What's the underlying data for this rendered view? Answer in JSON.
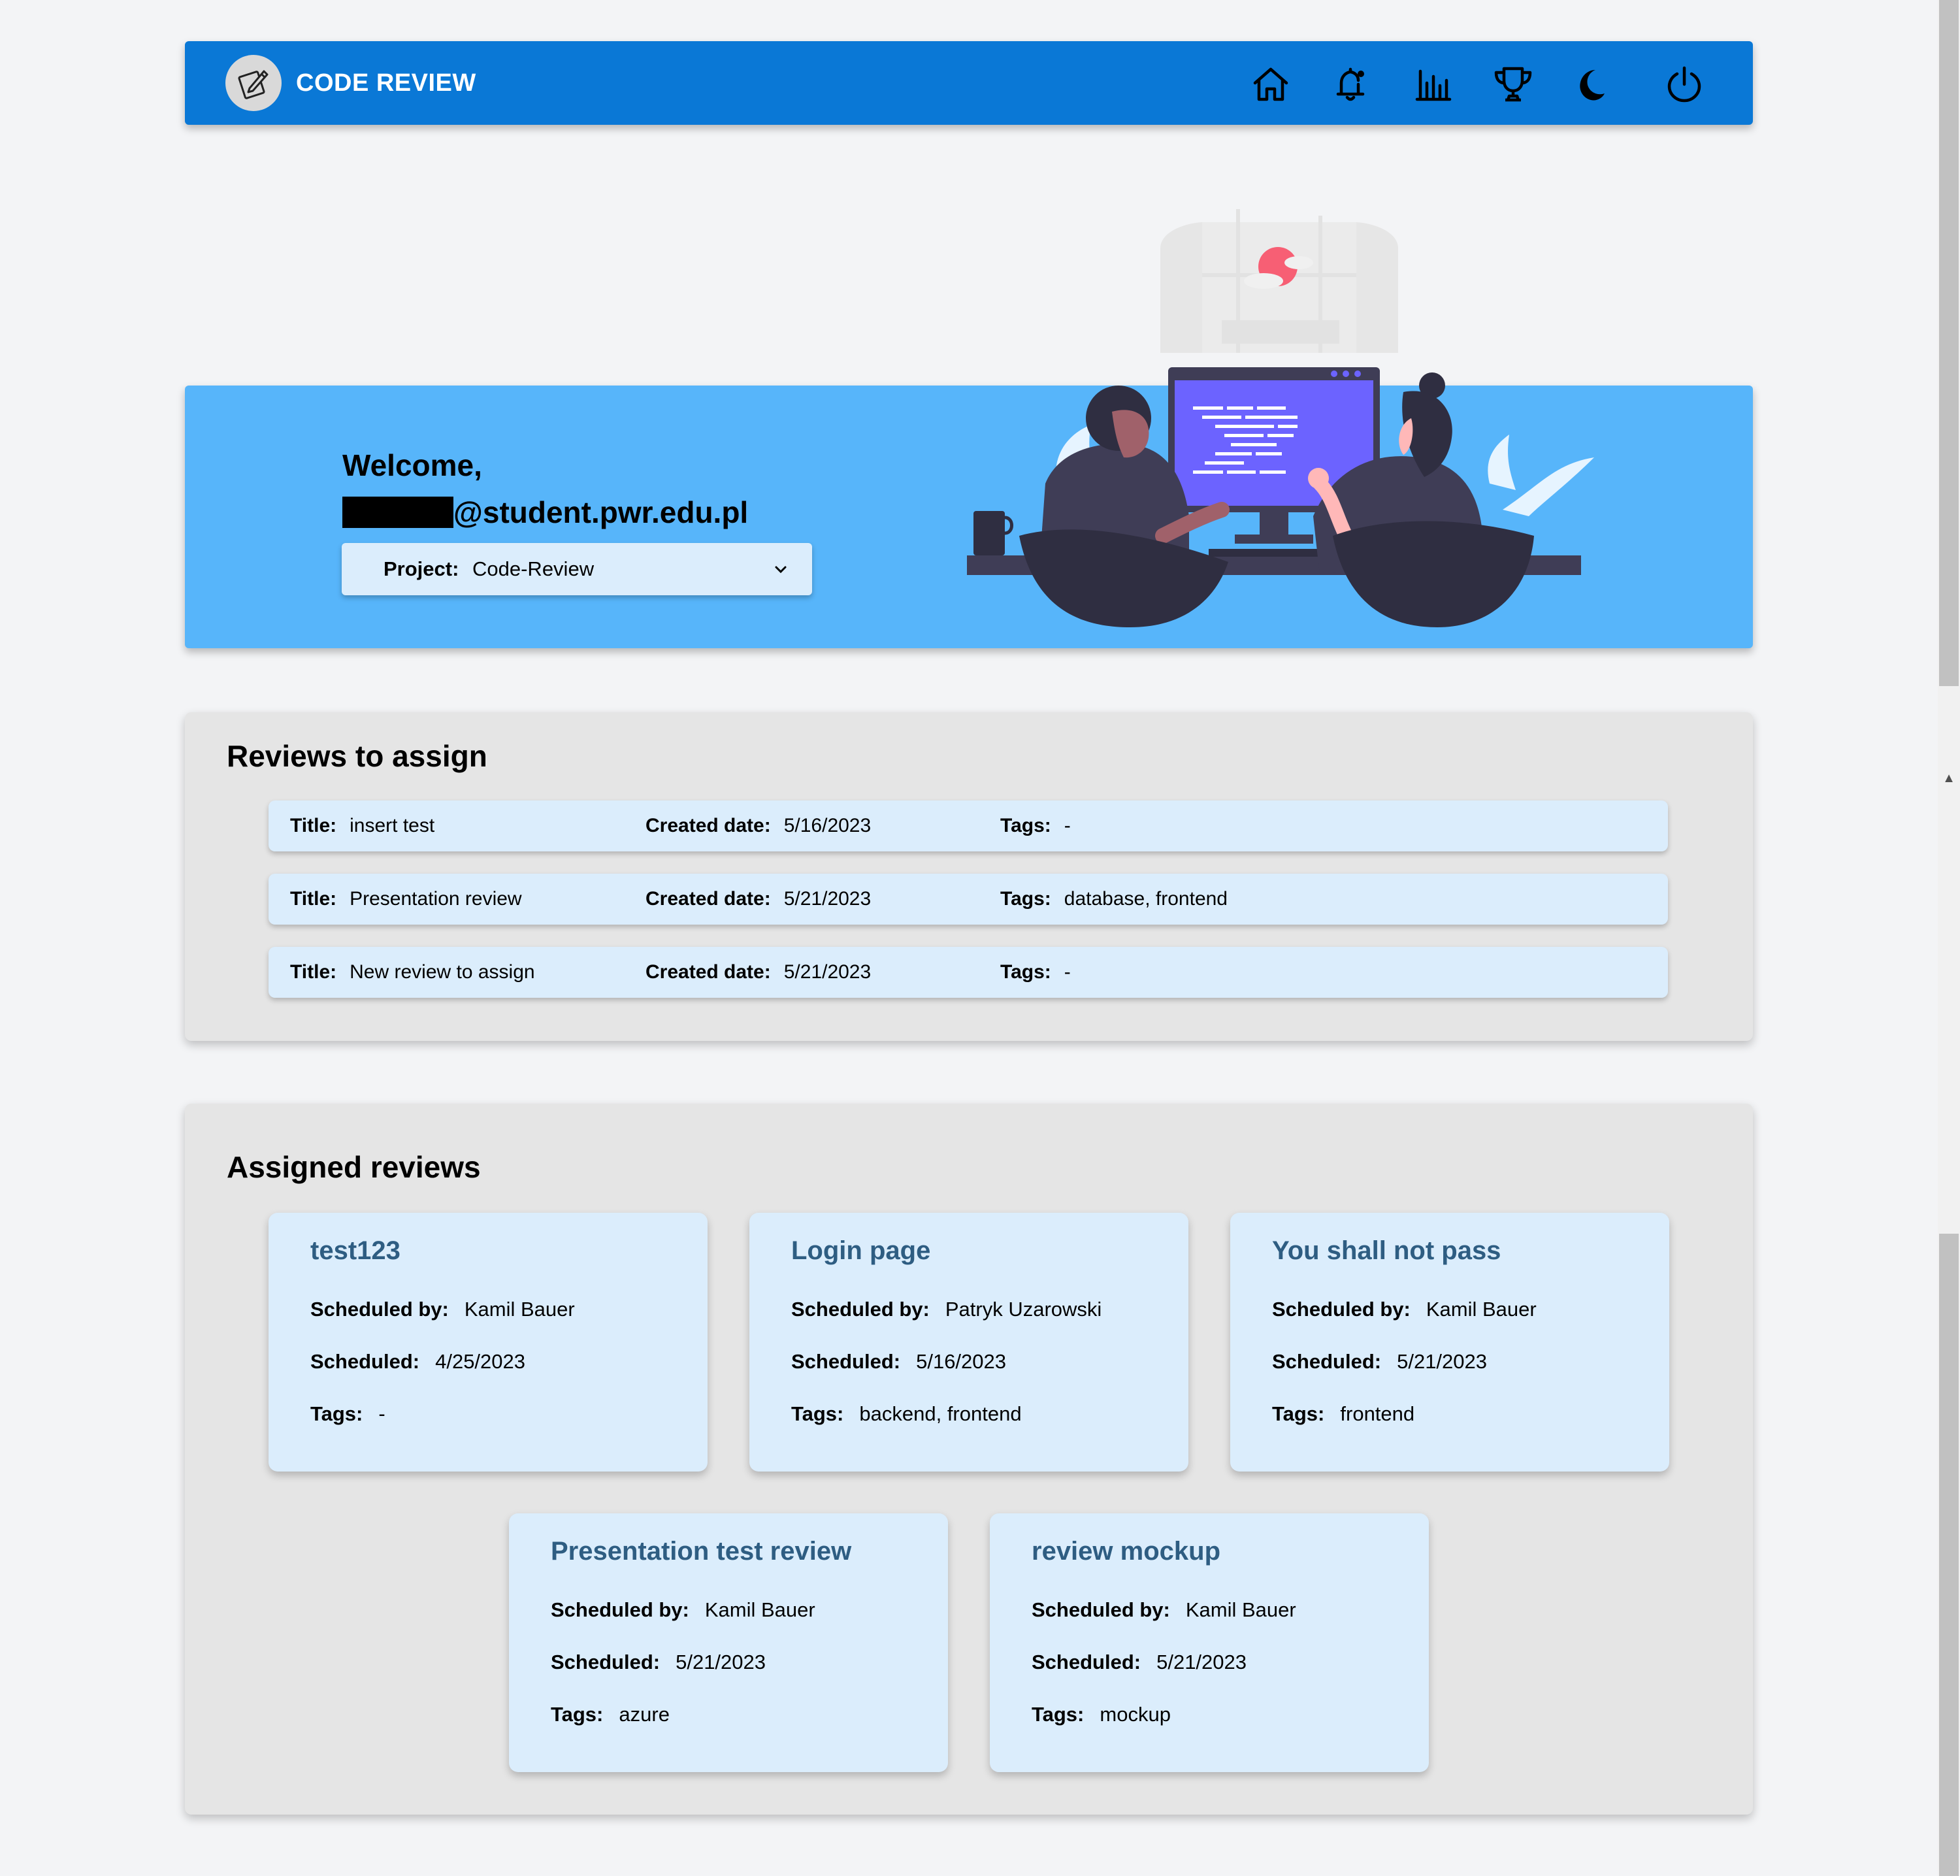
{
  "header": {
    "app_title": "CODE REVIEW",
    "logo_icon": "edit-note-icon",
    "nav_icons": [
      "home-icon",
      "notification-bell-icon",
      "bar-chart-icon",
      "trophy-icon",
      "dark-mode-moon-icon",
      "power-icon"
    ],
    "background_color": "#0a78d6"
  },
  "welcome": {
    "greeting": "Welcome,",
    "email_suffix": "@student.pwr.edu.pl",
    "project_label": "Project:",
    "project_value": "Code-Review",
    "banner_color": "#57b5fa"
  },
  "reviews_to_assign": {
    "heading": "Reviews to assign",
    "labels": {
      "title": "Title:",
      "created": "Created date:",
      "tags": "Tags:"
    },
    "rows": [
      {
        "title": "insert test",
        "created": "5/16/2023",
        "tags": "-"
      },
      {
        "title": "Presentation review",
        "created": "5/21/2023",
        "tags": "database, frontend"
      },
      {
        "title": "New review to assign",
        "created": "5/21/2023",
        "tags": "-"
      }
    ]
  },
  "assigned_reviews": {
    "heading": "Assigned reviews",
    "labels": {
      "scheduled_by": "Scheduled by:",
      "scheduled": "Scheduled:",
      "tags": "Tags:"
    },
    "cards": [
      {
        "title": "test123",
        "scheduled_by": "Kamil Bauer",
        "scheduled": "4/25/2023",
        "tags": "-"
      },
      {
        "title": "Login page",
        "scheduled_by": "Patryk Uzarowski",
        "scheduled": "5/16/2023",
        "tags": "backend, frontend"
      },
      {
        "title": "You shall not pass",
        "scheduled_by": "Kamil Bauer",
        "scheduled": "5/21/2023",
        "tags": "frontend"
      },
      {
        "title": "Presentation test review",
        "scheduled_by": "Kamil Bauer",
        "scheduled": "5/21/2023",
        "tags": "azure"
      },
      {
        "title": "review mockup",
        "scheduled_by": "Kamil Bauer",
        "scheduled": "5/21/2023",
        "tags": "mockup"
      }
    ],
    "title_color": "#2e5d82"
  }
}
